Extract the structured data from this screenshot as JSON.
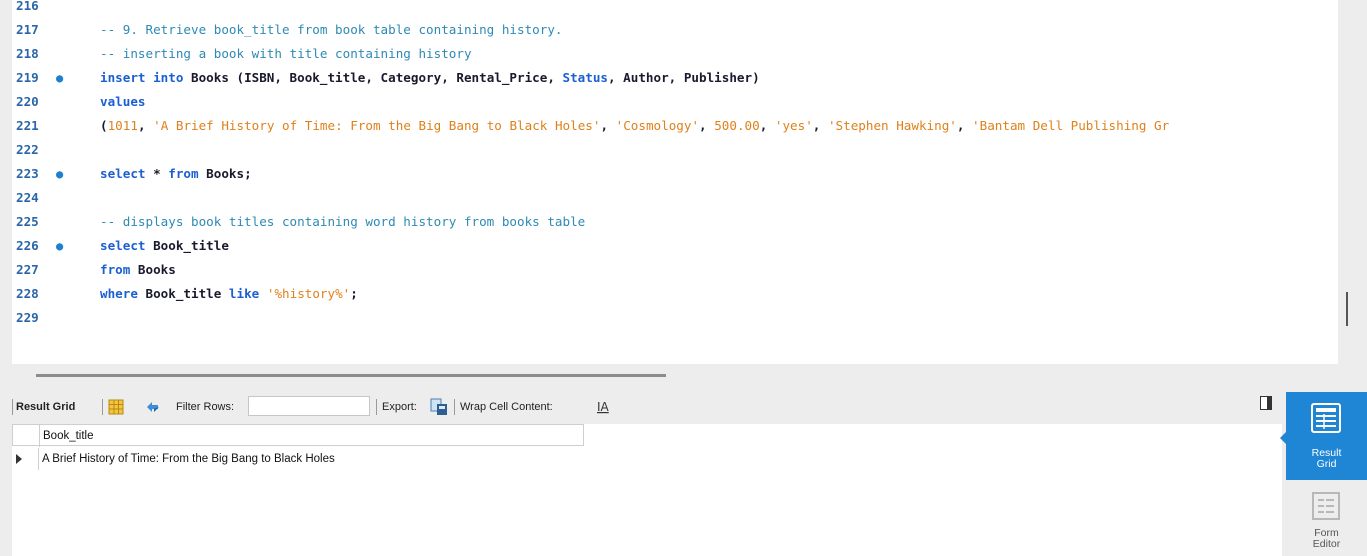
{
  "editor": {
    "lines": [
      {
        "num": "216",
        "dot": false,
        "tokens": []
      },
      {
        "num": "217",
        "dot": false,
        "tokens": [
          {
            "t": "cm",
            "v": "-- 9. Retrieve book_title from book table containing history."
          }
        ]
      },
      {
        "num": "218",
        "dot": false,
        "tokens": [
          {
            "t": "cm",
            "v": "-- inserting a book with title containing history"
          }
        ]
      },
      {
        "num": "219",
        "dot": true,
        "tokens": [
          {
            "t": "kw",
            "v": "insert into"
          },
          {
            "t": "tx",
            "v": " Books (ISBN, Book_title, Category, Rental_Price, "
          },
          {
            "t": "kw",
            "v": "Status"
          },
          {
            "t": "tx",
            "v": ", Author, Publisher)"
          }
        ]
      },
      {
        "num": "220",
        "dot": false,
        "tokens": [
          {
            "t": "kw",
            "v": "values"
          }
        ]
      },
      {
        "num": "221",
        "dot": false,
        "tokens": [
          {
            "t": "tx",
            "v": "("
          },
          {
            "t": "nm",
            "v": "1011"
          },
          {
            "t": "tx",
            "v": ", "
          },
          {
            "t": "st",
            "v": "'A Brief History of Time: From the Big Bang to Black Holes'"
          },
          {
            "t": "tx",
            "v": ", "
          },
          {
            "t": "st",
            "v": "'Cosmology'"
          },
          {
            "t": "tx",
            "v": ", "
          },
          {
            "t": "nm",
            "v": "500.00"
          },
          {
            "t": "tx",
            "v": ", "
          },
          {
            "t": "st",
            "v": "'yes'"
          },
          {
            "t": "tx",
            "v": ", "
          },
          {
            "t": "st",
            "v": "'Stephen Hawking'"
          },
          {
            "t": "tx",
            "v": ", "
          },
          {
            "t": "st",
            "v": "'Bantam Dell Publishing Gr"
          }
        ]
      },
      {
        "num": "222",
        "dot": false,
        "tokens": []
      },
      {
        "num": "223",
        "dot": true,
        "tokens": [
          {
            "t": "kw",
            "v": "select"
          },
          {
            "t": "tx",
            "v": " * "
          },
          {
            "t": "kw",
            "v": "from"
          },
          {
            "t": "tx",
            "v": " Books;"
          }
        ]
      },
      {
        "num": "224",
        "dot": false,
        "tokens": []
      },
      {
        "num": "225",
        "dot": false,
        "tokens": [
          {
            "t": "cm",
            "v": "-- displays book titles containing word history from books table"
          }
        ]
      },
      {
        "num": "226",
        "dot": true,
        "tokens": [
          {
            "t": "kw",
            "v": "select"
          },
          {
            "t": "tx",
            "v": " Book_title"
          }
        ]
      },
      {
        "num": "227",
        "dot": false,
        "tokens": [
          {
            "t": "kw",
            "v": "from"
          },
          {
            "t": "tx",
            "v": " Books"
          }
        ]
      },
      {
        "num": "228",
        "dot": false,
        "tokens": [
          {
            "t": "kw",
            "v": "where"
          },
          {
            "t": "tx",
            "v": " Book_title "
          },
          {
            "t": "kw",
            "v": "like"
          },
          {
            "t": "tx",
            "v": " "
          },
          {
            "t": "st",
            "v": "'%history%'"
          },
          {
            "t": "tx",
            "v": ";"
          }
        ]
      },
      {
        "num": "229",
        "dot": false,
        "tokens": []
      }
    ]
  },
  "toolbar": {
    "result_grid": "Result Grid",
    "filter_rows": "Filter Rows:",
    "filter_value": "",
    "export": "Export:",
    "wrap_cell": "Wrap Cell Content:"
  },
  "grid": {
    "columns": [
      "Book_title"
    ],
    "rows": [
      [
        "A Brief History of Time: From the Big Bang to Black Holes"
      ]
    ]
  },
  "side": {
    "result_grid_label_1": "Result",
    "result_grid_label_2": "Grid",
    "form_editor_label_1": "Form",
    "form_editor_label_2": "Editor"
  },
  "colors": {
    "accent": "#1f86d6",
    "keyword": "#1c5fd2",
    "string": "#e0801a",
    "comment": "#2e8ab5"
  }
}
